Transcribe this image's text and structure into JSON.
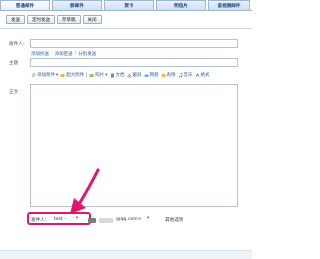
{
  "tabs": [
    {
      "label": "普通邮件"
    },
    {
      "label": "群邮件"
    },
    {
      "label": "贺卡"
    },
    {
      "label": "明信片"
    },
    {
      "label": "音视频邮件"
    }
  ],
  "actions": {
    "send": "发送",
    "timed_send": "定时发送",
    "save_draft": "存草稿",
    "close": "关闭"
  },
  "compose": {
    "to_label": "收件人：",
    "subject_label": "主题",
    "body_label": "正文",
    "links": {
      "cc": "添加抄送",
      "bcc": "添加密送",
      "separate": "分别发送",
      "sep": "-",
      "sep2": "|"
    },
    "toolbar": {
      "attach": "添加附件",
      "attach_caret": "▾",
      "large_attach": "超大附件",
      "photo": "照片",
      "photo_caret": "▾",
      "doc": "文档",
      "screenshot": "截屏",
      "grid": "网盘",
      "emoji": "表情",
      "music": "音乐",
      "format": "格式"
    }
  },
  "sender": {
    "label": "发件人：",
    "value": "test -",
    "caret": "▾",
    "domain": "@qq.com>",
    "more_caret": "▾",
    "more_options": "其他选项"
  },
  "colors": {
    "highlight": "#e0176e",
    "link": "#2a5db0",
    "tab_text": "#20437a"
  }
}
